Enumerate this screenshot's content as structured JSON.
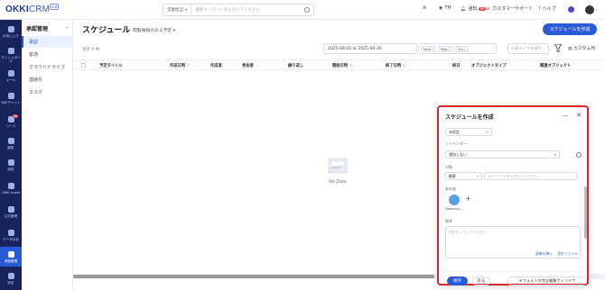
{
  "header": {
    "logo_main": "OKKI",
    "logo_crm": "CRM",
    "logo_version": "2.0",
    "search_scope": "営業担当",
    "search_placeholder": "検索キーワードを入力してください",
    "items": [
      "TM",
      "通知",
      "カスタマーサポート",
      "ヘルプ"
    ],
    "notify_badge": "99"
  },
  "sidebar": {
    "items": [
      {
        "label": "お気に入り",
        "icon": "star-icon"
      },
      {
        "label": "ダッシュボード",
        "icon": "dashboard-icon"
      },
      {
        "label": "メール",
        "icon": "mail-icon"
      },
      {
        "label": "SNSチャット",
        "icon": "chat-icon"
      },
      {
        "label": "リード",
        "icon": "lead-icon",
        "badge": "18"
      },
      {
        "label": "顧客",
        "icon": "customer-icon"
      },
      {
        "label": "商談",
        "icon": "deal-icon"
      },
      {
        "label": "OKKI Leads",
        "icon": "leads-icon"
      },
      {
        "label": "注文管理",
        "icon": "order-icon"
      },
      {
        "label": "データ分析",
        "icon": "analytics-icon"
      },
      {
        "label": "承認管理",
        "icon": "approval-icon"
      },
      {
        "label": "設定",
        "icon": "settings-icon"
      }
    ]
  },
  "submenu": {
    "title": "承認管理",
    "collapse": "«",
    "items": [
      "承認",
      "客通",
      "クラウドドライブ",
      "連絡先",
      "タスク"
    ]
  },
  "main": {
    "title": "スケジュール",
    "filter_dropdown": "閲覧権限のある予定 ▾",
    "create_button": "スケジュールを作成",
    "total": "合計 0 件",
    "date_range": "2025-06-01 to 2025-06-30",
    "tags": [
      "hsle...",
      "Ryo...",
      "+4..."
    ],
    "obj_type_placeholder": "対象タイプを選択...",
    "columns_button": "カスタム列",
    "columns": [
      "予定タイトル",
      "作成日時",
      "作成者",
      "参加者",
      "繰り返し",
      "開始日時",
      "終了日時",
      "終日",
      "オブジェクトタイプ",
      "関連オブジェクト"
    ],
    "empty_text": "No Data"
  },
  "modal": {
    "title": "スケジュールを作成",
    "minimize": "—",
    "close": "✕",
    "status_value": "未設定",
    "reminder_label": "リマインダー",
    "reminder_value": "通知しない",
    "target_label": "対象",
    "target_type": "顧客",
    "target_placeholder": "キーワードを入力してください",
    "participants_label": "参加者",
    "participant_name": "Nolenaru...",
    "notes_label": "備考",
    "notes_placeholder": "内容を入力してください",
    "insert_image": "画像を挿入",
    "attach_file": "添付ファイル",
    "save": "保存",
    "back": "戻る",
    "default_window": "デフォルトの完全編集ウィンドウ"
  }
}
